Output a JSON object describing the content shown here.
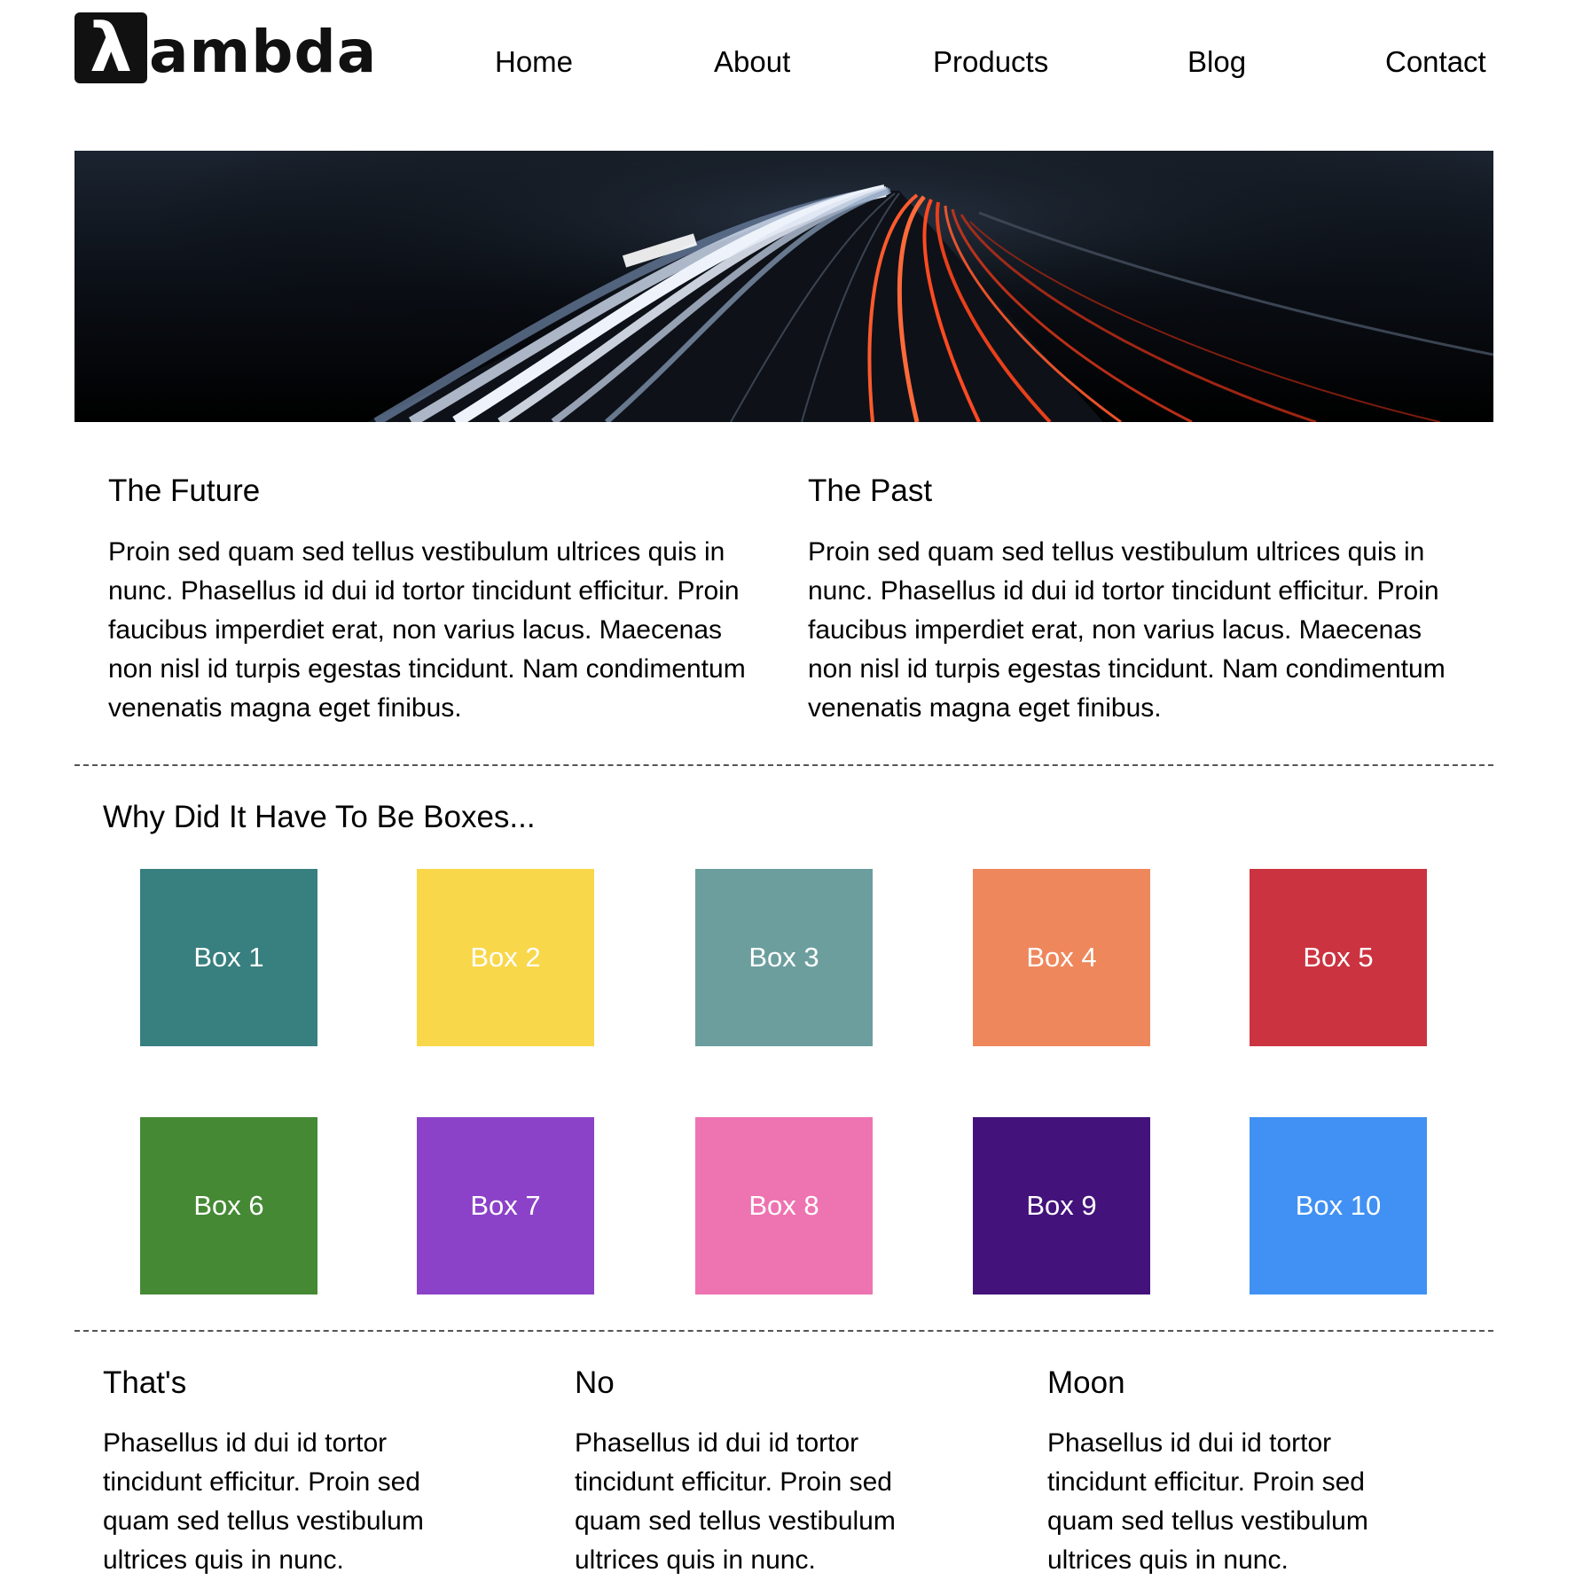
{
  "header": {
    "logo": {
      "mark": "λ",
      "text": "ambda"
    },
    "nav": [
      {
        "label": "Home"
      },
      {
        "label": "About"
      },
      {
        "label": "Products"
      },
      {
        "label": "Blog"
      },
      {
        "label": "Contact"
      }
    ]
  },
  "hero": {
    "image": "highway-light-trails-at-night"
  },
  "articles": [
    {
      "title": "The Future",
      "text": "Proin sed quam sed tellus vestibulum ultrices quis in nunc. Phasellus id dui id tortor tincidunt efficitur. Proin faucibus imperdiet erat, non varius lacus. Maecenas non nisl id turpis egestas tincidunt. Nam condimentum venenatis magna eget finibus."
    },
    {
      "title": "The Past",
      "text": "Proin sed quam sed tellus vestibulum ultrices quis in nunc. Phasellus id dui id tortor tincidunt efficitur. Proin faucibus imperdiet erat, non varius lacus. Maecenas non nisl id turpis egestas tincidunt. Nam condimentum venenatis magna eget finibus."
    }
  ],
  "boxes_section": {
    "title": "Why Did It Have To Be Boxes...",
    "boxes": [
      {
        "label": "Box 1",
        "color": "#387f7f"
      },
      {
        "label": "Box 2",
        "color": "#f9d74a"
      },
      {
        "label": "Box 3",
        "color": "#6c9e9e"
      },
      {
        "label": "Box 4",
        "color": "#ef875c"
      },
      {
        "label": "Box 5",
        "color": "#cb3341"
      },
      {
        "label": "Box 6",
        "color": "#458935"
      },
      {
        "label": "Box 7",
        "color": "#8b42c8"
      },
      {
        "label": "Box 8",
        "color": "#ee73b1"
      },
      {
        "label": "Box 9",
        "color": "#43127a"
      },
      {
        "label": "Box 10",
        "color": "#4191f4"
      }
    ]
  },
  "bottom": [
    {
      "title": "That's",
      "text": "Phasellus id dui id tortor tincidunt efficitur. Proin sed quam sed tellus vestibulum ultrices quis in nunc."
    },
    {
      "title": "No",
      "text": "Phasellus id dui id tortor tincidunt efficitur. Proin sed quam sed tellus vestibulum ultrices quis in nunc."
    },
    {
      "title": "Moon",
      "text": "Phasellus id dui id tortor tincidunt efficitur. Proin sed quam sed tellus vestibulum ultrices quis in nunc."
    }
  ]
}
